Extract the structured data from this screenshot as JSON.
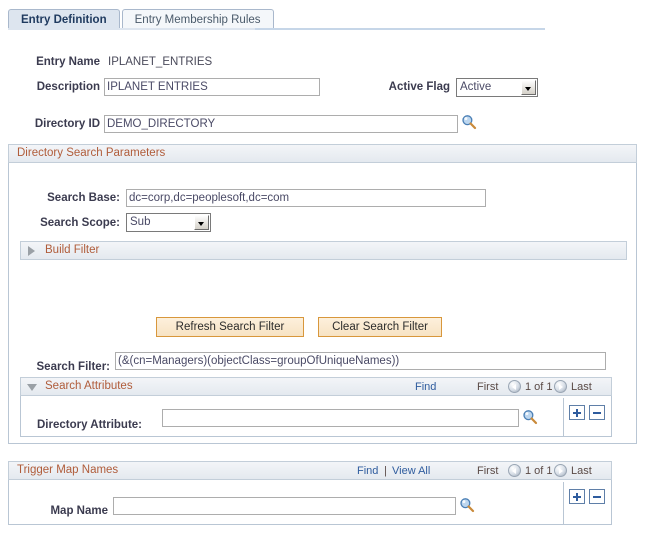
{
  "tabs": [
    {
      "label": "Entry Definition",
      "active": true
    },
    {
      "label": "Entry Membership Rules",
      "active": false
    }
  ],
  "header_fields": {
    "entry_name_label": "Entry Name",
    "entry_name_value": "IPLANET_ENTRIES",
    "description_label": "Description",
    "description_value": "IPLANET ENTRIES",
    "active_flag_label": "Active Flag",
    "active_flag_value": "Active",
    "directory_id_label": "Directory ID",
    "directory_id_value": "DEMO_DIRECTORY"
  },
  "search_params": {
    "title": "Directory Search Parameters",
    "search_base_label": "Search Base:",
    "search_base_value": "dc=corp,dc=peoplesoft,dc=com",
    "search_scope_label": "Search Scope:",
    "search_scope_value": "Sub",
    "build_filter_title": "Build Filter",
    "build_filter_expanded": false,
    "refresh_button": "Refresh Search Filter",
    "clear_button": "Clear Search Filter",
    "search_filter_label": "Search Filter:",
    "search_filter_value": "(&(cn=Managers)(objectClass=groupOfUniqueNames))"
  },
  "search_attributes": {
    "title": "Search Attributes",
    "expanded": true,
    "find_label": "Find",
    "first_label": "First",
    "counter_label": "1 of 1",
    "last_label": "Last",
    "directory_attribute_label": "Directory Attribute:",
    "directory_attribute_value": ""
  },
  "trigger_map": {
    "title": "Trigger Map Names",
    "find_label": "Find",
    "separator": "|",
    "view_all_label": "View All",
    "first_label": "First",
    "counter_label": "1 of 1",
    "last_label": "Last",
    "map_name_label": "Map Name",
    "map_name_value": ""
  },
  "colors": {
    "section_title": "#b05c3a",
    "link": "#2f5c9e",
    "button_border": "#d8973c",
    "tab_active_bg": "#dde5ef"
  }
}
